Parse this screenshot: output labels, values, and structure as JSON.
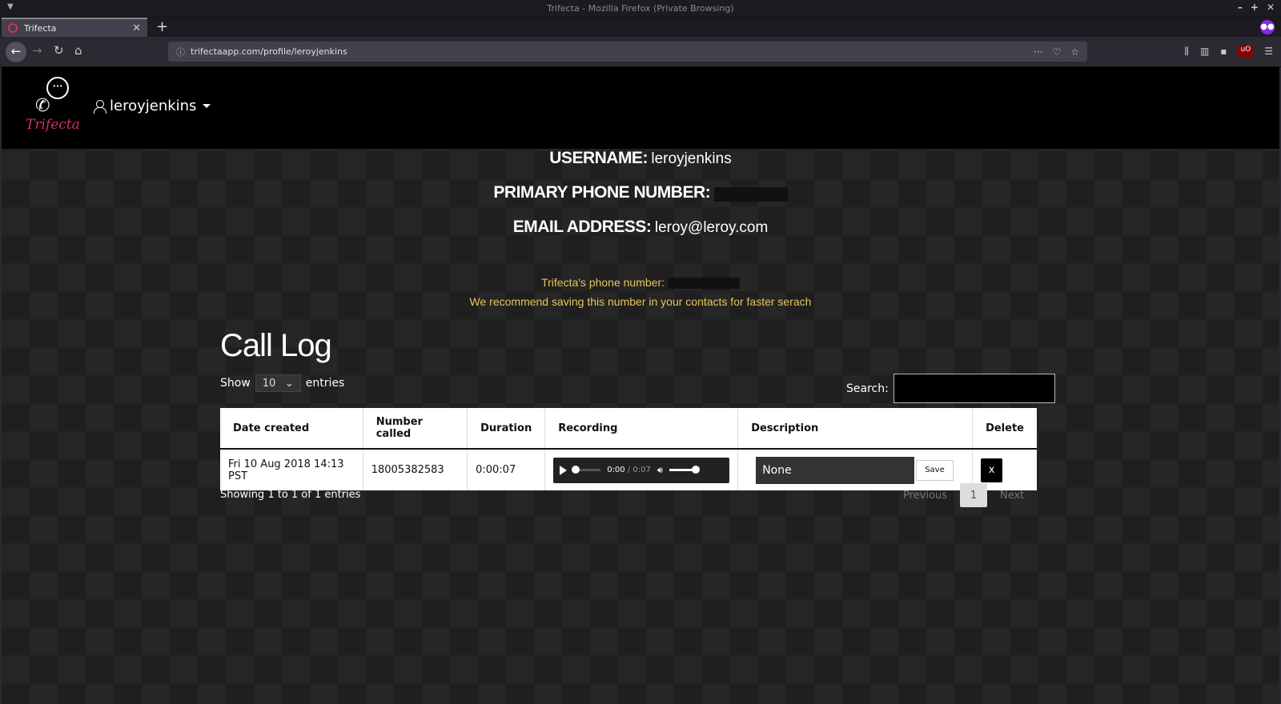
{
  "window": {
    "title": "Trifecta - Mozilla Firefox (Private Browsing)",
    "tab_title": "Trifecta",
    "new_tab": "+",
    "url": "trifectaapp.com/profile/leroyjenkins"
  },
  "header": {
    "logo_text": "Trifecta",
    "username_menu": "leroyjenkins"
  },
  "profile": {
    "username_label": "USERNAME:",
    "username_value": "leroyjenkins",
    "phone_label": "PRIMARY PHONE NUMBER:",
    "email_label": "EMAIL ADDRESS:",
    "email_value": "leroy@leroy.com",
    "trifecta_phone_label": "Trifecta's phone number:",
    "recommend": "We recommend saving this number in your contacts for faster serach"
  },
  "call_log": {
    "title": "Call Log",
    "show_label": "Show",
    "entries_value": "10",
    "entries_label": "entries",
    "search_label": "Search:",
    "columns": [
      "Date created",
      "Number called",
      "Duration",
      "Recording",
      "Description",
      "Delete"
    ],
    "rows": [
      {
        "date": "Fri 10 Aug 2018 14:13 PST",
        "number": "18005382583",
        "duration": "0:00:07",
        "audio_current": "0:00",
        "audio_total": "/ 0:07",
        "description": "None",
        "save_label": "Save",
        "delete_label": "x"
      }
    ],
    "showing": "Showing 1 to 1 of 1 entries",
    "pagination": {
      "previous": "Previous",
      "current": "1",
      "next": "Next"
    }
  },
  "colors": {
    "brand": "#d2335c",
    "info_text": "#e6c65a"
  }
}
